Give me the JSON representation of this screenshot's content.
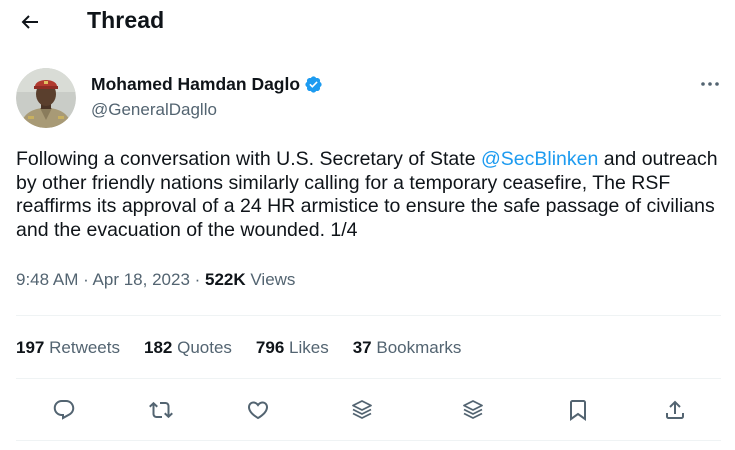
{
  "header": {
    "title": "Thread"
  },
  "author": {
    "name": "Mohamed Hamdan Daglo",
    "handle": "@GeneralDagllo"
  },
  "tweet": {
    "text_before": "Following a conversation with U.S. Secretary of State ",
    "mention": "@SecBlinken",
    "text_after": " and outreach by other friendly nations similarly calling for a temporary ceasefire, The RSF reaffirms its approval of a 24 HR armistice to ensure the safe passage of civilians and the evacuation of the wounded. 1/4",
    "time": "9:48 AM",
    "separator": " · ",
    "date": "Apr 18, 2023",
    "views_count": "522K",
    "views_label": " Views"
  },
  "stats": [
    {
      "count": "197",
      "label": "Retweets"
    },
    {
      "count": "182",
      "label": "Quotes"
    },
    {
      "count": "796",
      "label": "Likes"
    },
    {
      "count": "37",
      "label": "Bookmarks"
    }
  ],
  "icons": {
    "back": "arrow-left-icon",
    "verified": "verified-badge-icon",
    "more": "more-horizontal-icon",
    "reply": "reply-icon",
    "retweet": "retweet-icon",
    "like": "heart-icon",
    "layers1": "layers-icon",
    "layers2": "layers-icon",
    "bookmark": "bookmark-icon",
    "share": "share-icon"
  },
  "colors": {
    "accent": "#1d9bf0",
    "text": "#0f1419",
    "secondary": "#536471",
    "divider": "#eff3f4"
  }
}
